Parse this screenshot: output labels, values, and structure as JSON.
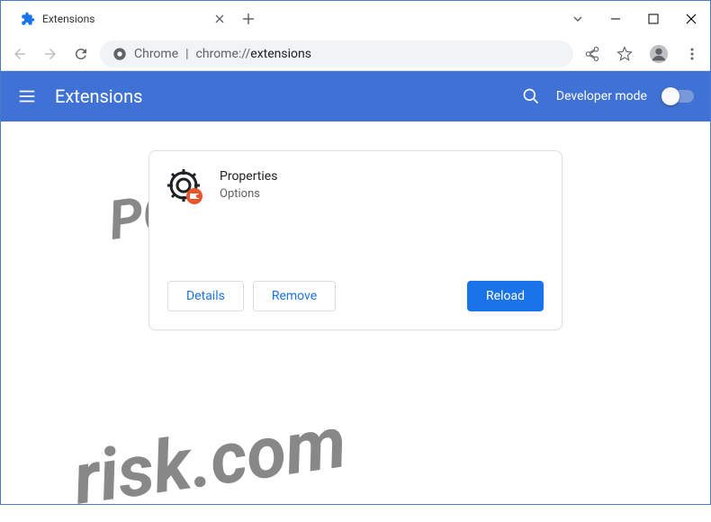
{
  "window": {
    "tab_title": "Extensions"
  },
  "address": {
    "host": "Chrome",
    "divider": "|",
    "prefix": "chrome://",
    "path": "extensions"
  },
  "header": {
    "title": "Extensions",
    "developer_mode_label": "Developer mode"
  },
  "extension": {
    "name": "Properties",
    "description": "Options",
    "details_label": "Details",
    "remove_label": "Remove",
    "reload_label": "Reload"
  },
  "watermark": {
    "line1": "PC",
    "line2": "risk.com"
  }
}
